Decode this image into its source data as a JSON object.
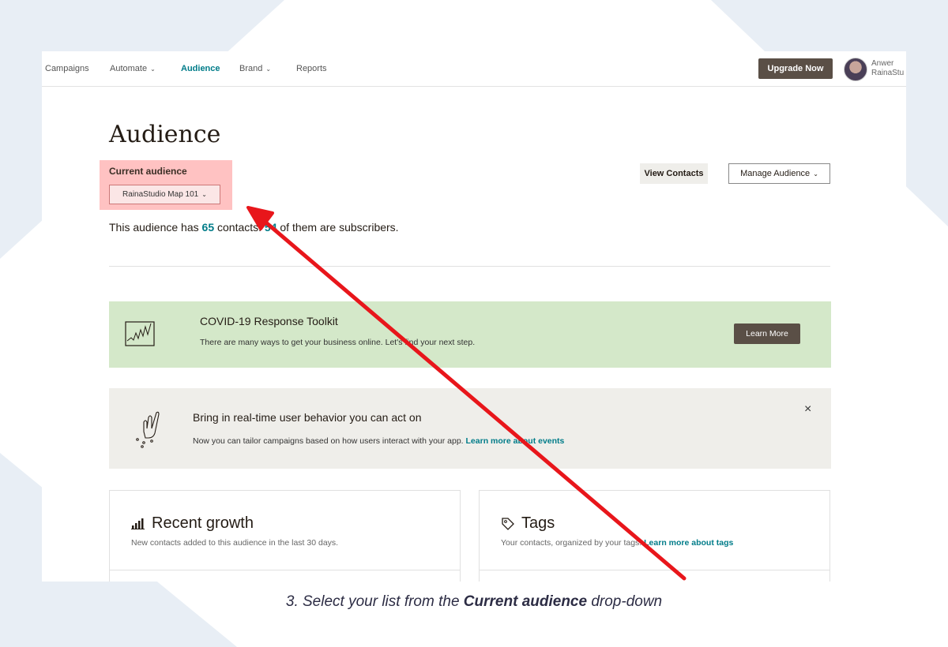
{
  "nav": {
    "items": [
      {
        "label": "Campaigns"
      },
      {
        "label": "Automate",
        "has_dropdown": true
      },
      {
        "label": "Audience",
        "active": true
      },
      {
        "label": "Brand",
        "has_dropdown": true
      },
      {
        "label": "Reports"
      }
    ],
    "upgrade_label": "Upgrade Now",
    "user": {
      "name": "Anwer",
      "org": "RainaStu"
    }
  },
  "page": {
    "title": "Audience",
    "current_audience_label": "Current audience",
    "current_audience_value": "RainaStudio Map 101",
    "view_contacts_label": "View Contacts",
    "manage_audience_label": "Manage Audience",
    "summary": {
      "prefix": "This audience has ",
      "contacts": "65",
      "middle": " contacts. ",
      "subscribers": "54",
      "suffix": " of them are subscribers."
    }
  },
  "covid_banner": {
    "title": "COVID-19 Response Toolkit",
    "text": "There are many ways to get your business online. Let's find your next step.",
    "button_label": "Learn More"
  },
  "events_banner": {
    "title": "Bring in real-time user behavior you can act on",
    "text": "Now you can tailor campaigns based on how users interact with your app. ",
    "link": "Learn more about events",
    "close": "×"
  },
  "cards": {
    "growth": {
      "title": "Recent growth",
      "desc": "New contacts added to this audience in the last 30 days."
    },
    "tags": {
      "title": "Tags",
      "desc": "Your contacts, organized by your tags. ",
      "link": "Learn more about tags"
    }
  },
  "caption": {
    "prefix": "3. Select your list from the ",
    "bold": "Current audience",
    "suffix": " drop-down"
  },
  "colors": {
    "accent_teal": "#007c89",
    "annotation_red": "#e8161b",
    "highlight": "#ff7878",
    "covid_bg": "#d4e8c9"
  }
}
